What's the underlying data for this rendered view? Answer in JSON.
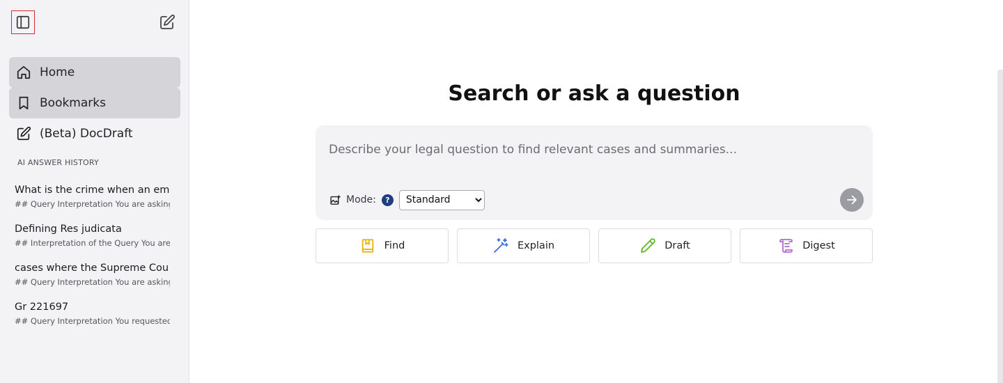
{
  "sidebar": {
    "nav": [
      {
        "label": "Home",
        "icon": "home-icon"
      },
      {
        "label": "Bookmarks",
        "icon": "bookmark-icon"
      },
      {
        "label": "(Beta) DocDraft",
        "icon": "edit-icon"
      }
    ],
    "history_title": "AI ANSWER HISTORY",
    "history": [
      {
        "title": "What is the crime when an em",
        "snippet": "## Query Interpretation You are asking"
      },
      {
        "title": "Defining Res judicata",
        "snippet": "## Interpretation of the Query You are r"
      },
      {
        "title": "cases where the Supreme Cou",
        "snippet": "## Query Interpretation You are asking t"
      },
      {
        "title": "Gr 221697",
        "snippet": "## Query Interpretation You requested"
      }
    ]
  },
  "main": {
    "headline": "Search or ask a question",
    "search_placeholder": "Describe your legal question to find relevant cases and summaries...",
    "mode_label": "Mode:",
    "help_glyph": "?",
    "mode_selected": "Standard",
    "actions": [
      {
        "label": "Find",
        "icon": "book-icon",
        "color": "#e8b000"
      },
      {
        "label": "Explain",
        "icon": "magic-wand-icon",
        "color": "#3b6fe0"
      },
      {
        "label": "Draft",
        "icon": "pencil-icon",
        "color": "#5fb82a"
      },
      {
        "label": "Digest",
        "icon": "scroll-icon",
        "color": "#b06ad0"
      }
    ]
  },
  "colors": {
    "sidebar_bg": "#f3f3f5",
    "active_nav_bg": "#d5d5d9",
    "help_icon": "#1d3f80",
    "send_button": "#9b9ba3"
  }
}
